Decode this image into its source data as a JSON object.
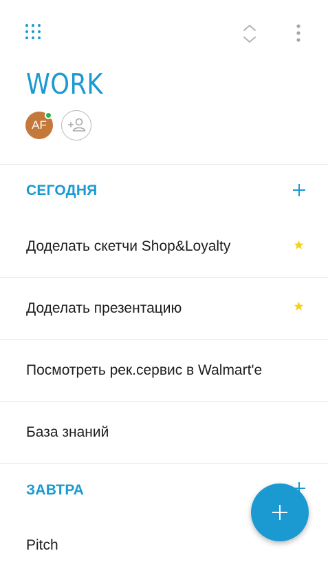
{
  "header": {
    "title": "WORK",
    "apps_icon": "apps-grid-icon",
    "collapse_icon": "expand-collapse-icon",
    "more_icon": "more-vertical-icon"
  },
  "members": {
    "avatar_initials": "AF",
    "avatar_color": "#c4783a",
    "presence_color": "#2bb24c",
    "add_member_icon": "add-person-icon"
  },
  "sections": [
    {
      "title": "СЕГОДНЯ",
      "tasks": [
        {
          "text": "Доделать скетчи Shop&Loyalty",
          "starred": true
        },
        {
          "text": "Доделать презентацию",
          "starred": true
        },
        {
          "text": "Посмотреть рек.сервис в Walmart'е",
          "starred": false
        },
        {
          "text": "База знаний",
          "starred": false
        }
      ]
    },
    {
      "title": "ЗАВТРА",
      "tasks": [
        {
          "text": "Pitch",
          "starred": false
        }
      ]
    }
  ],
  "colors": {
    "accent": "#1a9ad1",
    "star": "#f2d21b",
    "divider": "#e2e2e2",
    "text": "#1d1d1d"
  },
  "fab_icon": "plus-icon"
}
